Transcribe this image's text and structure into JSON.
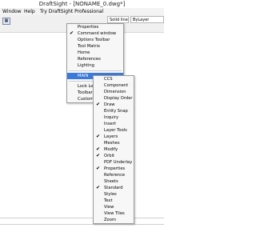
{
  "window": {
    "title": "DraftSight - [NONAME_0.dwg*]"
  },
  "menubar": {
    "items": [
      "Window",
      "Help",
      "Try DraftSight Professional"
    ]
  },
  "toolbar": {
    "linestyle": "Solid line",
    "layer": "ByLayer"
  },
  "main_menu": {
    "items": [
      {
        "label": "Properties",
        "checked": false
      },
      {
        "label": "Command window",
        "checked": true
      },
      {
        "label": "Options Toolbar",
        "checked": false
      },
      {
        "label": "Tool Matrix",
        "checked": false
      },
      {
        "label": "Home",
        "checked": false
      },
      {
        "label": "References",
        "checked": false
      },
      {
        "label": "Lighting",
        "checked": false
      },
      {
        "label": "MAIN",
        "submenu": true,
        "highlighted": true
      },
      {
        "label": "Lock Location",
        "submenu": true
      },
      {
        "label": "Toolbars...",
        "checked": false
      },
      {
        "label": "Customize Interface...",
        "checked": false
      }
    ]
  },
  "sub_menu": {
    "items": [
      {
        "label": "CCS",
        "checked": false
      },
      {
        "label": "Component",
        "checked": false
      },
      {
        "label": "Dimension",
        "checked": false
      },
      {
        "label": "Display Order",
        "checked": false
      },
      {
        "label": "Draw",
        "checked": true
      },
      {
        "label": "Entity Snap",
        "checked": false
      },
      {
        "label": "Inquiry",
        "checked": false
      },
      {
        "label": "Insert",
        "checked": false
      },
      {
        "label": "Layer Tools",
        "checked": false
      },
      {
        "label": "Layers",
        "checked": true
      },
      {
        "label": "Meshes",
        "checked": false
      },
      {
        "label": "Modify",
        "checked": true
      },
      {
        "label": "Orbit",
        "checked": true
      },
      {
        "label": "PDF Underlay",
        "checked": false
      },
      {
        "label": "Properties",
        "checked": true
      },
      {
        "label": "Reference",
        "checked": false
      },
      {
        "label": "Sheets",
        "checked": false
      },
      {
        "label": "Standard",
        "checked": true
      },
      {
        "label": "Styles",
        "checked": false
      },
      {
        "label": "Text",
        "checked": false
      },
      {
        "label": "View",
        "checked": false
      },
      {
        "label": "View Tiles",
        "checked": false
      },
      {
        "label": "Zoom",
        "checked": false
      }
    ]
  },
  "glyphs": {
    "check": "✔",
    "arrow": "▸"
  }
}
